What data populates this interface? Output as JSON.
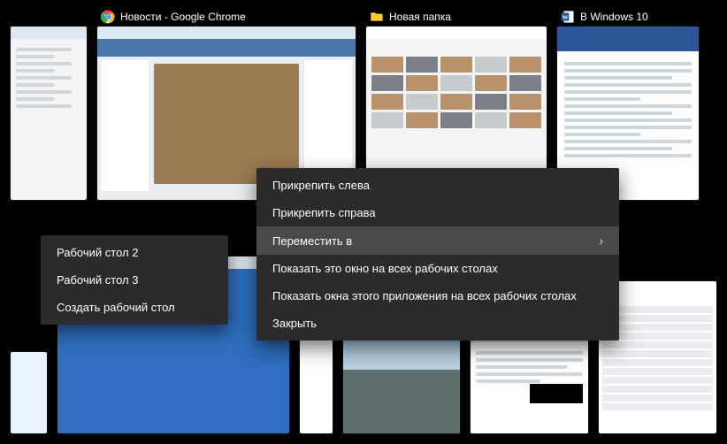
{
  "windows": {
    "chrome": {
      "title": "Новости - Google Chrome",
      "icon": "chrome-icon"
    },
    "explorer": {
      "title": "Новая папка",
      "icon": "folder-icon"
    },
    "word": {
      "title": "В Windows 10",
      "icon": "word-icon"
    }
  },
  "context_menu": {
    "snap_left": "Прикрепить слева",
    "snap_right": "Прикрепить справа",
    "move_to": "Переместить в",
    "show_window_all": "Показать это окно на всех рабочих столах",
    "show_app_all": "Показать окна этого приложения на всех рабочих столах",
    "close": "Закрыть"
  },
  "desktops_submenu": {
    "desktop2": "Рабочий стол 2",
    "desktop3": "Рабочий стол 3",
    "new_desktop": "Создать рабочий стол"
  },
  "colors": {
    "menu_bg": "#2b2b2b",
    "menu_hover": "#4a4a4a",
    "text": "#ffffff"
  }
}
